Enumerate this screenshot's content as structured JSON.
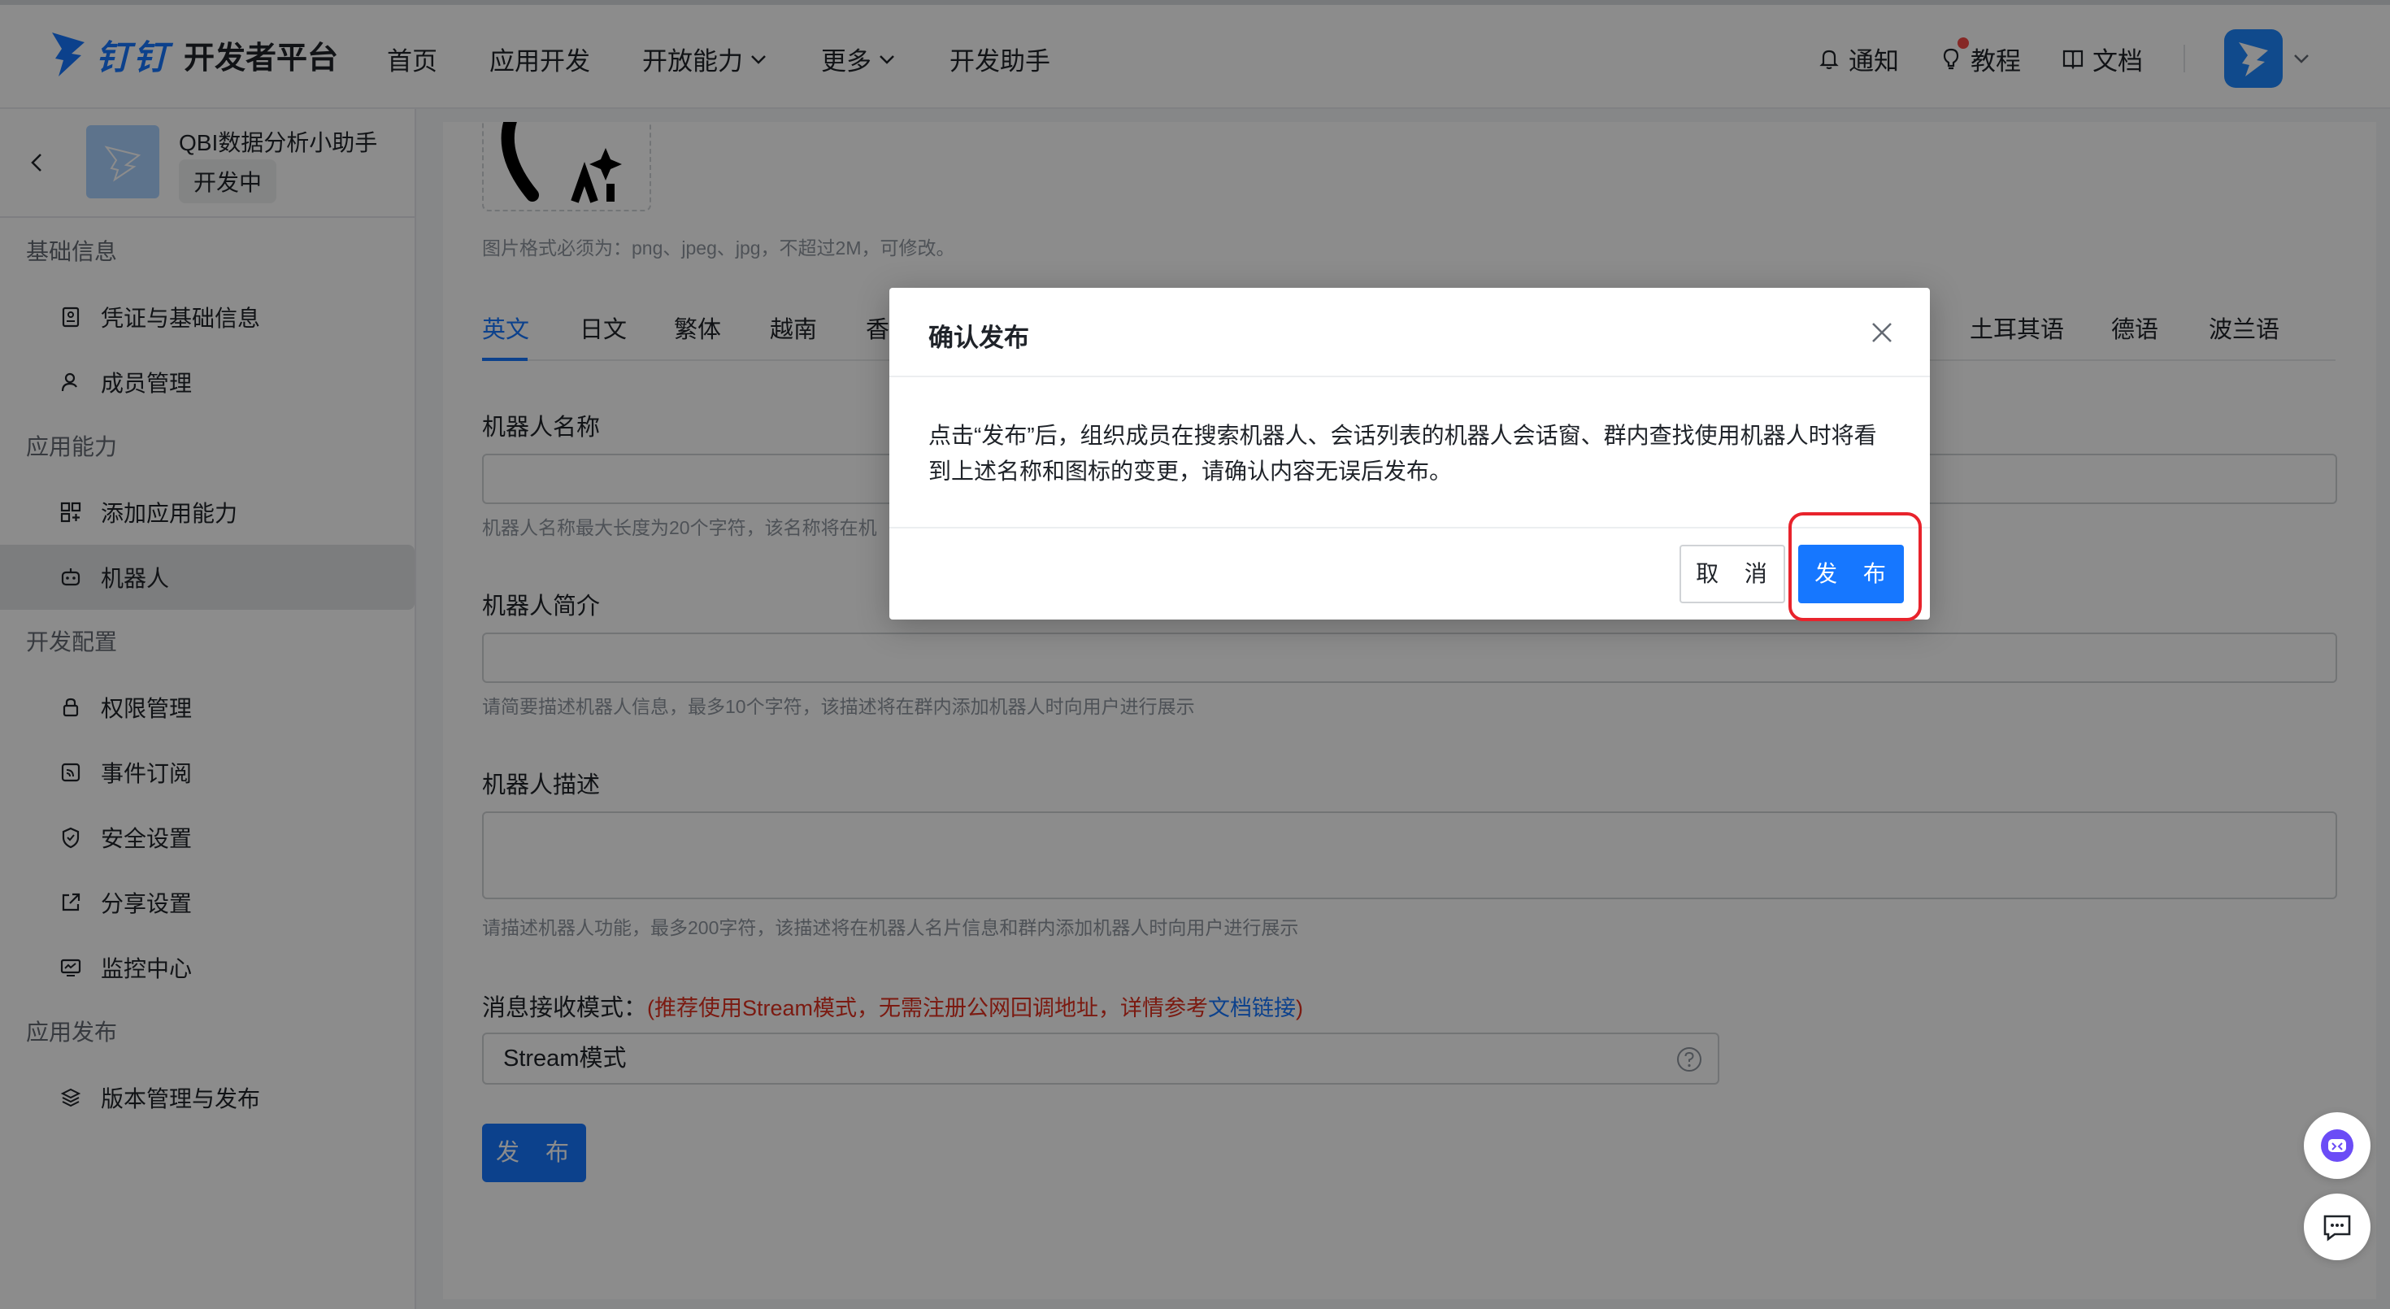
{
  "header": {
    "brand": "钉钉",
    "platform": "开发者平台",
    "nav": [
      {
        "label": "首页"
      },
      {
        "label": "应用开发"
      },
      {
        "label": "开放能力"
      },
      {
        "label": "更多"
      },
      {
        "label": "开发助手"
      }
    ],
    "tools": {
      "notify": "通知",
      "tutorial": "教程",
      "docs": "文档"
    }
  },
  "app": {
    "name": "QBI数据分析小助手",
    "status": "开发中"
  },
  "sidebar": {
    "sections": [
      {
        "title": "基础信息",
        "items": [
          {
            "label": "凭证与基础信息"
          },
          {
            "label": "成员管理"
          }
        ]
      },
      {
        "title": "应用能力",
        "items": [
          {
            "label": "添加应用能力"
          },
          {
            "label": "机器人"
          }
        ]
      },
      {
        "title": "开发配置",
        "items": [
          {
            "label": "权限管理"
          },
          {
            "label": "事件订阅"
          },
          {
            "label": "安全设置"
          },
          {
            "label": "分享设置"
          },
          {
            "label": "监控中心"
          }
        ]
      },
      {
        "title": "应用发布",
        "items": [
          {
            "label": "版本管理与发布"
          }
        ]
      }
    ]
  },
  "main": {
    "icon_hint": "图片格式必须为：png、jpeg、jpg，不超过2M，可修改。",
    "tabs": [
      "英文",
      "日文",
      "繁体",
      "越南",
      "香",
      "土耳其语",
      "德语",
      "波兰语"
    ],
    "name_label": "机器人名称",
    "name_hint": "机器人名称最大长度为20个字符，该名称将在机",
    "intro_label": "机器人简介",
    "intro_hint": "请简要描述机器人信息，最多10个字符，该描述将在群内添加机器人时向用户进行展示",
    "desc_label": "机器人描述",
    "desc_hint": "请描述机器人功能，最多200字符，该描述将在机器人名片信息和群内添加机器人时向用户进行展示",
    "mode_label": "消息接收模式：",
    "mode_note_before": "(推荐使用Stream模式，无需注册公网回调地址，详情参考",
    "mode_note_link": "文档链接",
    "mode_note_after": ")",
    "mode_value": "Stream模式",
    "publish": "发 布"
  },
  "dialog": {
    "title": "确认发布",
    "body": "点击“发布”后，组织成员在搜索机器人、会话列表的机器人会话窗、群内查找使用机器人时将看到上述名称和图标的变更，请确认内容无误后发布。",
    "cancel": "取 消",
    "confirm": "发 布"
  },
  "colors": {
    "primary": "#1677ff",
    "highlight": "#e8232c",
    "note_red": "#e0311f"
  }
}
